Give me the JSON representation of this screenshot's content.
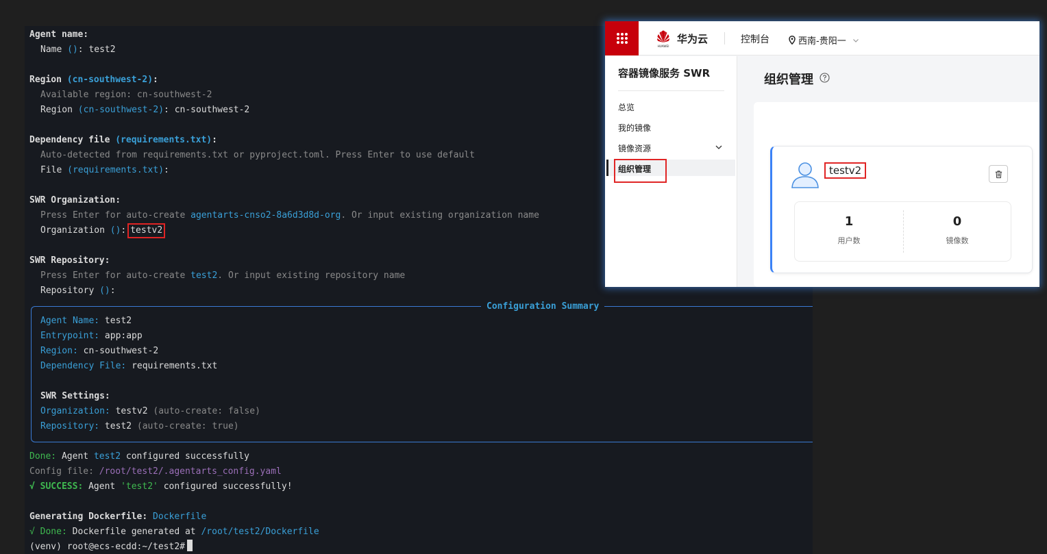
{
  "terminal": {
    "agent_name_header": "Agent name:",
    "name_prompt_label": "Name",
    "name_prompt_default": "()",
    "name_value": "test2",
    "region_header": "Region",
    "region_header_default": "(cn-southwest-2)",
    "available_region": "Available region: cn-southwest-2",
    "region_prompt_label": "Region",
    "region_prompt_default": "(cn-southwest-2)",
    "region_value": "cn-southwest-2",
    "dependency_header": "Dependency file",
    "dependency_header_default": "(requirements.txt)",
    "dependency_hint": "Auto-detected from requirements.txt or pyproject.toml. Press Enter to use default",
    "file_prompt_label": "File",
    "file_prompt_default": "(requirements.txt)",
    "swr_org_header": "SWR Organization:",
    "org_hint_prefix": "Press Enter for auto-create",
    "org_hint_default": "agentarts-cnso2-8a6d3d8d-org",
    "org_hint_suffix": ". Or input existing organization name",
    "org_prompt_label": "Organization",
    "org_prompt_default": "()",
    "org_value": "testv2",
    "swr_repo_header": "SWR Repository:",
    "repo_hint_prefix": "Press Enter for auto-create",
    "repo_hint_default": "test2",
    "repo_hint_suffix": ". Or input existing repository name",
    "repo_prompt_label": "Repository",
    "repo_prompt_default": "()",
    "summary_title": "Configuration Summary",
    "summary": {
      "agent_name_label": "Agent Name:",
      "agent_name_value": "test2",
      "entrypoint_label": "Entrypoint:",
      "entrypoint_value": "app:app",
      "region_label": "Region:",
      "region_value": "cn-southwest-2",
      "dependency_label": "Dependency File:",
      "dependency_value": "requirements.txt",
      "swr_settings": "SWR Settings:",
      "organization_label": "Organization:",
      "organization_value": "testv2",
      "organization_note": "(auto-create: false)",
      "repository_label": "Repository:",
      "repository_value": "test2",
      "repository_note": "(auto-create: true)"
    },
    "done_label": "Done:",
    "done_agent_prefix": "Agent",
    "done_agent_name": "test2",
    "done_agent_suffix": "configured successfully",
    "config_file_label": "Config file:",
    "config_file_dir": "/root/test2/",
    "config_file_name": ".agentarts_config.yaml",
    "success_mark": "√",
    "success_label": "SUCCESS:",
    "success_prefix": "Agent",
    "success_agent": "'test2'",
    "success_suffix": "configured successfully!",
    "gen_dockerfile_label": "Generating Dockerfile:",
    "gen_dockerfile_value": "Dockerfile",
    "done2_mark": "√",
    "done2_label": "Done:",
    "done2_text": "Dockerfile generated at",
    "done2_path": "/root/test2/Dockerfile",
    "prompt": "(venv) root@ecs-ecdd:~/test2#"
  },
  "console": {
    "brand_name": "华为云",
    "logo_text": "HUAWEI",
    "console_link": "控制台",
    "region": "西南-贵阳一",
    "service_title": "容器镜像服务 SWR",
    "nav": [
      "总览",
      "我的镜像",
      "镜像资源",
      "组织管理"
    ],
    "active_nav": "组织管理",
    "page_title": "组织管理",
    "org_card": {
      "name": "testv2",
      "user_count": "1",
      "user_count_label": "用户数",
      "image_count": "0",
      "image_count_label": "镜像数"
    },
    "colors": {
      "brand_red": "#c7000b",
      "card_accent": "#3b82f6",
      "highlight_box": "#e02424"
    }
  }
}
